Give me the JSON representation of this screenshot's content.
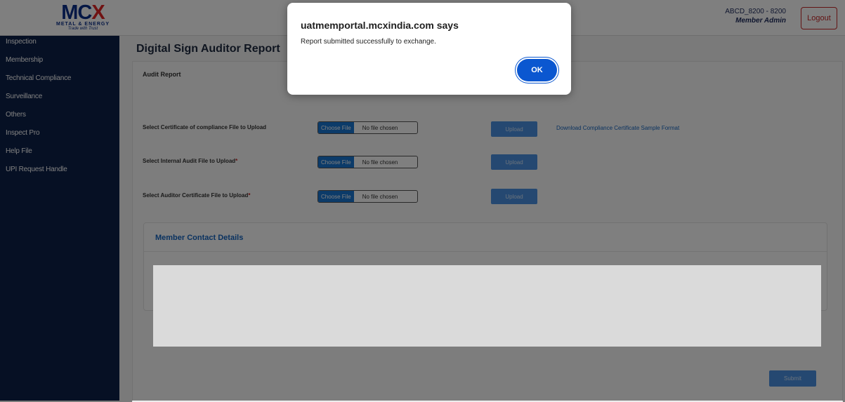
{
  "header": {
    "logo": {
      "main": "MCX",
      "sub": "METAL & ENERGY",
      "tagline": "Trade with Trust"
    },
    "user": {
      "id": "ABCD_8200 - 8200",
      "role": "Member Admin"
    },
    "logout_label": "Logout"
  },
  "sidebar": {
    "items": [
      {
        "label": "Inspection"
      },
      {
        "label": "Membership"
      },
      {
        "label": "Technical Compliance"
      },
      {
        "label": "Surveillance"
      },
      {
        "label": "Others"
      },
      {
        "label": "Inspect Pro"
      },
      {
        "label": "Help File"
      },
      {
        "label": "UPI Request Handle"
      }
    ]
  },
  "main": {
    "title": "Digital Sign Auditor Report",
    "section_label": "Audit Report",
    "uploads": [
      {
        "label": "Select Certificate of compliance File to Upload",
        "required": "",
        "choose_label": "Choose File",
        "file_status": "No file chosen",
        "upload_label": "Upload"
      },
      {
        "label": "Select Internal Audit File to Upload",
        "required": "*",
        "choose_label": "Choose File",
        "file_status": "No file chosen",
        "upload_label": "Upload"
      },
      {
        "label": "Select Auditor Certificate File to Upload",
        "required": "*",
        "choose_label": "Choose File",
        "file_status": "No file chosen",
        "upload_label": "Upload"
      }
    ],
    "download_link": "Download Compliance Certificate Sample Format",
    "contact_title": "Member Contact Details",
    "submit_label": "Submit"
  },
  "dialog": {
    "title": "uatmemportal.mcxindia.com says",
    "message": "Report submitted successfully to exchange.",
    "ok_label": "OK"
  },
  "colors": {
    "sidebar_bg": "#0c2049",
    "primary": "#1976d2",
    "dialog_button": "#0b57d0",
    "logout": "#c62828"
  }
}
